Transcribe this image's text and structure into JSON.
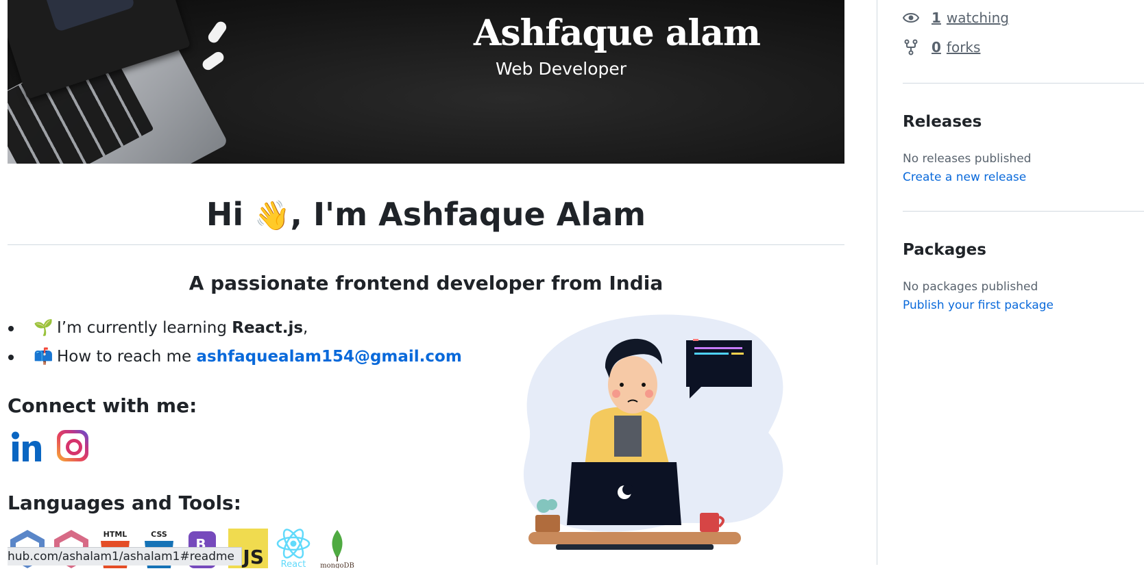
{
  "banner": {
    "title": "Ashfaque alam",
    "subtitle": "Web Developer"
  },
  "readme": {
    "greeting_prefix": "Hi ",
    "greeting_emoji": "👋",
    "greeting_suffix": ", I'm Ashfaque Alam",
    "tagline": "A passionate frontend developer from India",
    "facts": [
      {
        "emoji": "🌱",
        "text": "I’m currently learning ",
        "strong": "React.js",
        "tail": ","
      },
      {
        "emoji": "📫",
        "text": "How to reach me ",
        "link": "ashfaquealam154@gmail.com"
      }
    ],
    "connect_heading": "Connect with me:",
    "social_icons": [
      "linkedin-icon",
      "instagram-icon"
    ],
    "tools_heading": "Languages and Tools:",
    "tools": [
      "bootstrap-icon",
      "git-icon",
      "html5-icon",
      "css3-icon",
      "redux-icon",
      "javascript-icon",
      "react-icon",
      "mongodb-icon"
    ],
    "tool_labels": {
      "html": "HTML",
      "css": "CSS",
      "js": "JS",
      "react": "React",
      "mongo": "mongoDB"
    }
  },
  "statusbar": {
    "url": "hub.com/ashalam1/ashalam1#readme"
  },
  "sidebar": {
    "watching_count": "1",
    "watching_label": "watching",
    "forks_count": "0",
    "forks_label": "forks",
    "releases_heading": "Releases",
    "releases_empty": "No releases published",
    "releases_link": "Create a new release",
    "packages_heading": "Packages",
    "packages_empty": "No packages published",
    "packages_link": "Publish your first package"
  },
  "colors": {
    "link": "#0969da",
    "muted": "#59636e",
    "text": "#1f2328",
    "border": "#d1d9e0"
  }
}
